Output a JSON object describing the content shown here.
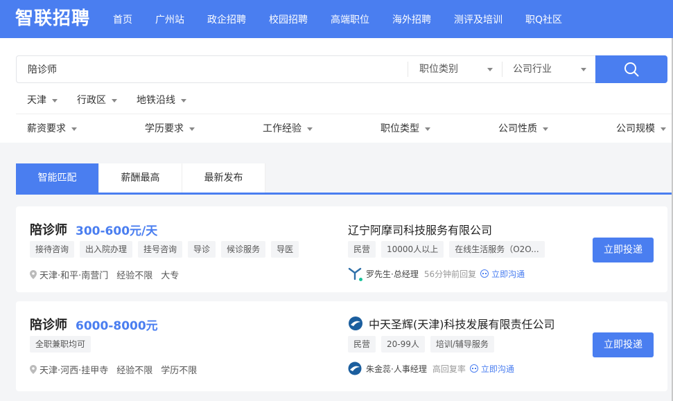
{
  "header": {
    "logo": "智联招聘",
    "nav": [
      "首页",
      "广州站",
      "政企招聘",
      "校园招聘",
      "高端职位",
      "海外招聘",
      "测评及培训",
      "职Q社区"
    ]
  },
  "search": {
    "query": "陪诊师",
    "category_select": "职位类别",
    "industry_select": "公司行业"
  },
  "filters": {
    "row1": [
      "天津",
      "行政区",
      "地铁沿线"
    ],
    "row2": [
      "薪资要求",
      "学历要求",
      "工作经验",
      "职位类型",
      "公司性质",
      "公司规模"
    ]
  },
  "tabs": [
    "智能匹配",
    "薪酬最高",
    "最新发布"
  ],
  "jobs": [
    {
      "title": "陪诊师",
      "salary": "300-600元/天",
      "tags": [
        "接待咨询",
        "出入院办理",
        "挂号咨询",
        "导诊",
        "候诊服务",
        "导医"
      ],
      "location": "天津·和平·南营门",
      "experience": "经验不限",
      "education": "大专",
      "company": "辽宁阿摩司科技服务有限公司",
      "company_tags": [
        "民营",
        "10000人以上",
        "在线生活服务（O2O..."
      ],
      "recruiter": "罗先生·总经理",
      "reply": "56分钟前回复",
      "chat": "立即沟通",
      "apply": "立即投递"
    },
    {
      "title": "陪诊师",
      "salary": "6000-8000元",
      "tags": [
        "全职兼职均可"
      ],
      "location": "天津·河西·挂甲寺",
      "experience": "经验不限",
      "education": "学历不限",
      "company": "中天圣辉(天津)科技发展有限责任公司",
      "company_tags": [
        "民营",
        "20-99人",
        "培训/辅导服务"
      ],
      "recruiter": "朱金蕊·人事经理",
      "reply": "高回复率",
      "chat": "立即沟通",
      "apply": "立即投递"
    }
  ],
  "colors": {
    "brand": "#4a7ef0",
    "page_bg": "#f4f5f7"
  },
  "icons": [
    "search-icon",
    "caret-down-icon",
    "location-pin-icon",
    "chat-icon",
    "company-logo-icon",
    "recruiter-avatar-icon"
  ]
}
